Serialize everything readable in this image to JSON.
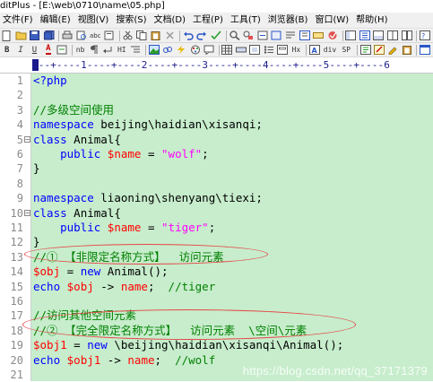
{
  "window": {
    "title": "ditPlus - [E:\\web\\0710\\name\\05.php]"
  },
  "menu": [
    "文件(F)",
    "编辑(E)",
    "视图(V)",
    "搜索(S)",
    "文档(D)",
    "工程(P)",
    "工具(T)",
    "浏览器(B)",
    "窗口(W)",
    "帮助(H)"
  ],
  "toolbar2": {
    "b": "B",
    "i": "I",
    "u": "U",
    "a": "A",
    "nb": "nb",
    "hr": "HI",
    "hx": "Hx",
    "div": "div",
    "sp": "SP"
  },
  "ruler": {
    "text": "---+----1----+----2----+----3----+----4----+----5----+----6"
  },
  "code": [
    {
      "n": "1",
      "t": "<?php"
    },
    {
      "n": "2",
      "t": ""
    },
    {
      "n": "3",
      "t": "//多级空间使用"
    },
    {
      "n": "4",
      "t": "namespace beijing\\haidian\\xisanqi;"
    },
    {
      "n": "5",
      "t": "class Animal{"
    },
    {
      "n": "6",
      "t": "    public $name = \"wolf\";"
    },
    {
      "n": "7",
      "t": "}"
    },
    {
      "n": "8",
      "t": ""
    },
    {
      "n": "9",
      "t": "namespace liaoning\\shenyang\\tiexi;"
    },
    {
      "n": "10",
      "t": "class Animal{"
    },
    {
      "n": "11",
      "t": "    public $name = \"tiger\";"
    },
    {
      "n": "12",
      "t": "}"
    },
    {
      "n": "13",
      "t": "//① 【非限定名称方式】  访问元素"
    },
    {
      "n": "14",
      "t": "$obj = new Animal();"
    },
    {
      "n": "15",
      "t": "echo $obj -> name;  //tiger"
    },
    {
      "n": "16",
      "t": ""
    },
    {
      "n": "17",
      "t": "//访问其他空间元素"
    },
    {
      "n": "18",
      "t": "//② 【完全限定名称方式】  访问元素  \\空间\\元素"
    },
    {
      "n": "19",
      "t": "$obj1 = new \\beijing\\haidian\\xisanqi\\Animal();"
    },
    {
      "n": "20",
      "t": "echo $obj1 -> name;  //wolf"
    },
    {
      "n": "21",
      "t": ""
    }
  ],
  "watermark": "https://blog.csdn.net/qq_37171379",
  "colors": {
    "editor_bg": "#c7edcc",
    "comment": "#008000",
    "keyword": "#0000ff",
    "string": "#ff00ff",
    "variable": "#ff0000",
    "annotation": "#e64545"
  }
}
